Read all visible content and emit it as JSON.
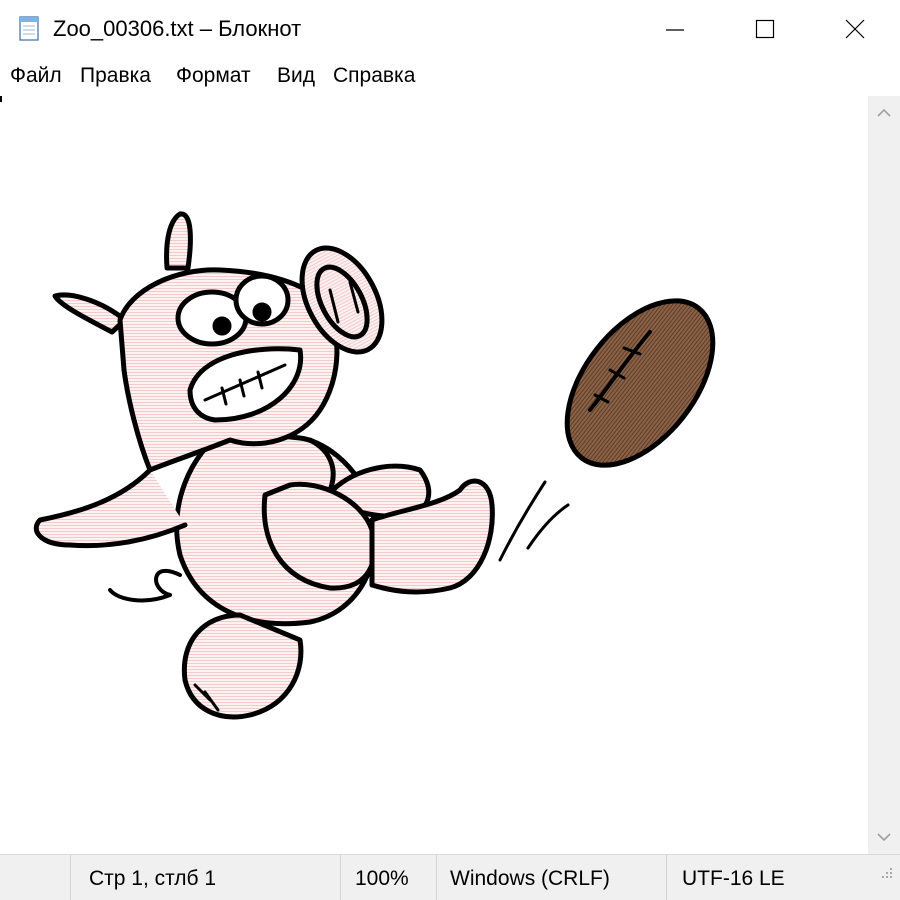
{
  "window": {
    "title": "Zoo_00306.txt – Блокнот",
    "icon": "notepad-icon"
  },
  "controls": {
    "minimize_icon": "minimize-icon",
    "maximize_icon": "maximize-icon",
    "close_icon": "close-icon"
  },
  "menu": {
    "items": [
      {
        "label": "Файл"
      },
      {
        "label": "Правка"
      },
      {
        "label": "Формат"
      },
      {
        "label": "Вид"
      },
      {
        "label": "Справка"
      }
    ]
  },
  "editor": {
    "content": "ASCII-art cartoon pig kicking an american football",
    "colors": {
      "pig": "#fbe3e3",
      "outline": "#000000",
      "ball": "#7a5236"
    }
  },
  "scrollbar": {
    "up_icon": "chevron-up-icon",
    "down_icon": "chevron-down-icon"
  },
  "status": {
    "position": "Стр 1, стлб 1",
    "zoom": "100%",
    "line_endings": "Windows (CRLF)",
    "encoding": "UTF-16 LE"
  }
}
